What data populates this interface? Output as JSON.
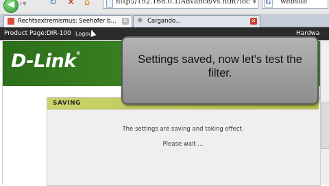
{
  "browser": {
    "url": "http://192.168.0.1/Advance/vs.htm?loc",
    "search_text": "website",
    "tabs": [
      {
        "label": "Rechtsextremismus: Seehofer b..."
      },
      {
        "label": "Cargando..."
      }
    ]
  },
  "router": {
    "product_page": "Product Page:DIR-100",
    "logout": "Logout",
    "hardware": "Hardwa",
    "logo": "D-Link",
    "saving_title": "SAVING",
    "saving_message": "The settings are saving and taking effect.",
    "wait_message": "Please wait ..."
  },
  "callout": {
    "text": "Settings saved, now let's test the filter."
  },
  "colors": {
    "brand_green": "#3f8a22",
    "saving_bar": "#c9d36a",
    "callout_bg": "#9e9e9e"
  }
}
